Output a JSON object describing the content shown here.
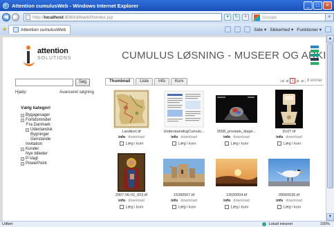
{
  "window": {
    "title": "Attention cumulusWeb - Windows Internet Explorer"
  },
  "addressbar": {
    "url_prefix": "http://",
    "url_host": "localhost",
    "url_path": ":8080/attweb/ifvindex.jsp",
    "search_placeholder": "Google"
  },
  "tabbar": {
    "tab_label": "Attention cumulusWeb",
    "cmd_side": "Side ▾",
    "cmd_sikkerhed": "Sikkerhed ▾",
    "cmd_funktioner": "Funktioner ▾"
  },
  "header": {
    "logo_word": "attention",
    "logo_sub": "SOLUTIONS",
    "headline": "CUMULUS LØSNING - MUSEER OG ARKIVER",
    "stack_colors": [
      "#2e86c1",
      "#27ae60",
      "#16a085",
      "#2c3e50",
      "#27ae60"
    ]
  },
  "sidebar": {
    "search_button": "Søg",
    "help_link": "Hjælp",
    "advanced_link": "Avanceret søgning",
    "category_title": "Vælg kategori",
    "categories": [
      {
        "label": "Bygagesager",
        "expand": "+"
      },
      {
        "label": "Fortidsminder",
        "expand": "+"
      },
      {
        "label": "Fra Danmark",
        "expand": ""
      },
      {
        "label": "Udenlandsk",
        "expand": "+"
      },
      {
        "label": "Bygninger",
        "expand": ""
      },
      {
        "label": "Genstande",
        "expand": ""
      },
      {
        "label": "Invitation",
        "expand": ""
      },
      {
        "label": "Kunder",
        "expand": "+"
      },
      {
        "label": "Nye billeder",
        "expand": ""
      },
      {
        "label": "P-Vagt",
        "expand": "+"
      },
      {
        "label": "PowerPoint",
        "expand": "+"
      }
    ]
  },
  "main": {
    "tabs": [
      "Thumbnail",
      "Liste",
      "Info",
      "Kurv"
    ],
    "pager": {
      "prev_first": "|◀",
      "prev": "◀",
      "page": "1",
      "next": "▶",
      "next_last": "▶|",
      "count": "8 emner"
    },
    "info_label": "info",
    "download_label": "download",
    "cart_label": "Læg i kurv",
    "items": [
      {
        "filename": "Landkort.tif",
        "icon": "map-thumbnail"
      },
      {
        "filename": "UnderstandingCumulu...",
        "icon": "document-thumbnail"
      },
      {
        "filename": "0558_prostate_doppl...",
        "icon": "ultrasound-thumbnail"
      },
      {
        "filename": "Dc07.tif",
        "icon": "lamp-thumbnail"
      },
      {
        "filename": "2007-06-02_003.tif",
        "icon": "painting-thumbnail"
      },
      {
        "filename": "15390007.tif",
        "icon": "castle-thumbnail"
      },
      {
        "filename": "13020004.tif",
        "icon": "sunset-thumbnail"
      },
      {
        "filename": "09060036.tif",
        "icon": "bird-thumbnail"
      }
    ]
  },
  "status": {
    "left": "Udført",
    "zone": "Lokalt intranet",
    "zoom": "100%"
  }
}
